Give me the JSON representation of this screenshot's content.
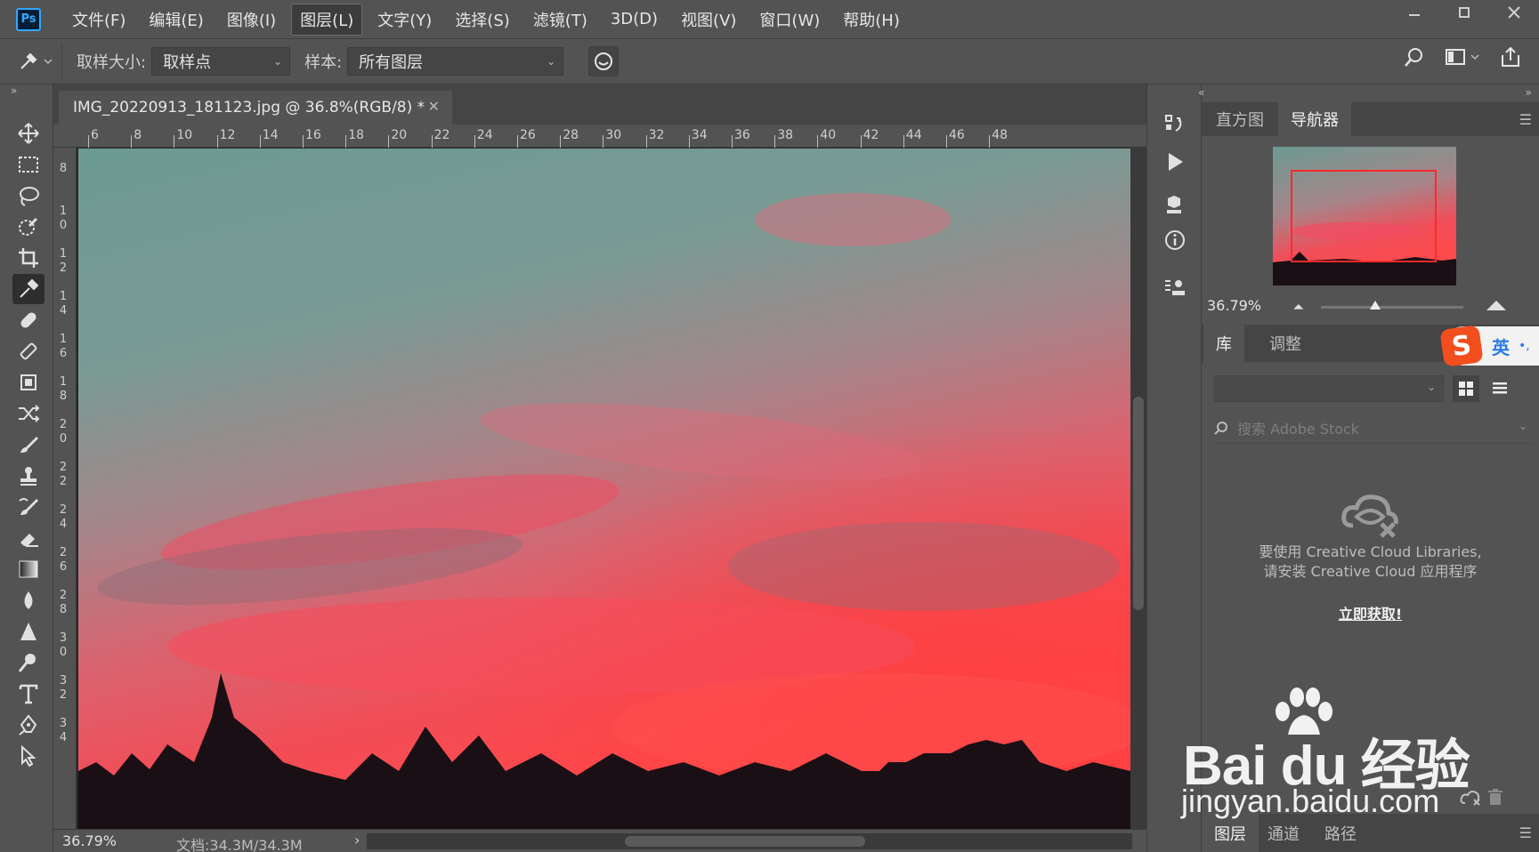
{
  "app": {
    "logo": "Ps",
    "menu": [
      "文件(F)",
      "编辑(E)",
      "图像(I)",
      "图层(L)",
      "文字(Y)",
      "选择(S)",
      "滤镜(T)",
      "3D(D)",
      "视图(V)",
      "窗口(W)",
      "帮助(H)"
    ],
    "active_menu_index": 3,
    "window_controls": [
      "minimize-icon",
      "maximize-icon",
      "close-icon"
    ]
  },
  "options": {
    "sample_size_label": "取样大小:",
    "sample_size_value": "取样点",
    "sample_label": "样本:",
    "sample_value": "所有图层"
  },
  "document": {
    "tab_title": "IMG_20220913_181123.jpg @ 36.8%(RGB/8) *",
    "ruler_top": [
      "6",
      "8",
      "10",
      "12",
      "14",
      "16",
      "18",
      "20",
      "22",
      "24",
      "26",
      "28",
      "30",
      "32",
      "34",
      "36",
      "38",
      "40",
      "42",
      "44",
      "46",
      "48"
    ],
    "ruler_left": [
      "8",
      "10",
      "12",
      "14",
      "16",
      "18",
      "20",
      "22",
      "24",
      "26",
      "28",
      "30",
      "32",
      "34"
    ]
  },
  "status": {
    "zoom": "36.79%",
    "doc_size": "文档:34.3M/34.3M"
  },
  "navigator_panel": {
    "tabs": [
      "直方图",
      "导航器"
    ],
    "active_tab_index": 1,
    "zoom": "36.79%",
    "zoom_slider_fraction": 0.38
  },
  "library_panel": {
    "tabs": [
      "库",
      "调整"
    ],
    "active_tab_index": 0,
    "search_placeholder": "搜索 Adobe Stock",
    "message_line1": "要使用 Creative Cloud Libraries,",
    "message_line2": "请安装 Creative Cloud 应用程序",
    "link": "立即获取!"
  },
  "layers_panel": {
    "tabs": [
      "图层",
      "通道",
      "路径"
    ],
    "active_tab_index": 0
  },
  "ime": {
    "logo": "S",
    "mode": "英"
  },
  "watermark": {
    "brand": "Bai du 经验",
    "url": "jingyan.baidu.com"
  },
  "colors": {
    "ps_blue": "#31a8ff",
    "nav_rect": "#ff2a2a",
    "ime_orange": "#f24e1e"
  }
}
